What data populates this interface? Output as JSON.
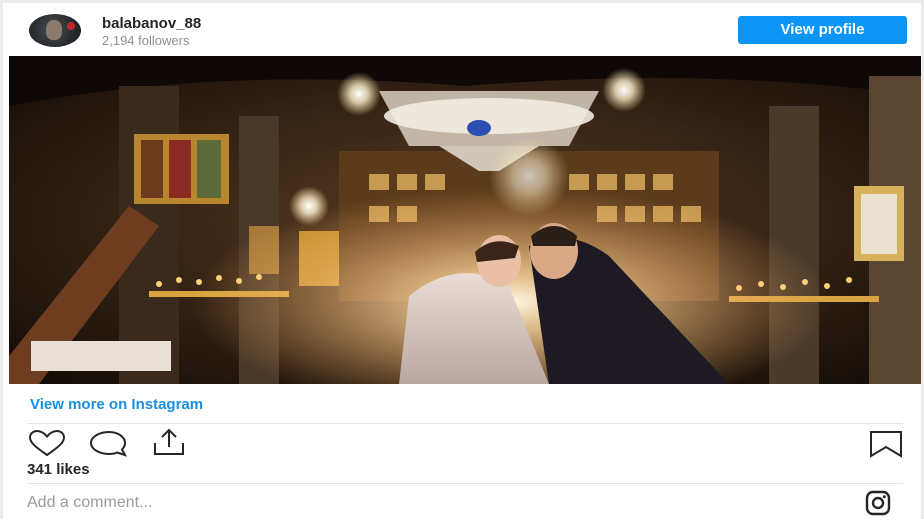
{
  "post": {
    "username": "balabanov_88",
    "followers": "2,194 followers",
    "view_profile_label": "View profile",
    "view_more_label": "View more on Instagram",
    "likes": "341 likes",
    "comment_placeholder": "Add a comment..."
  },
  "icons": {
    "like": "heart-icon",
    "comment": "comment-icon",
    "share": "share-icon",
    "save": "bookmark-icon",
    "brand": "instagram-icon"
  },
  "colors": {
    "accent": "#0d95f6",
    "link": "#1a8fe0",
    "muted": "#8e8e8e",
    "text": "#262626"
  }
}
